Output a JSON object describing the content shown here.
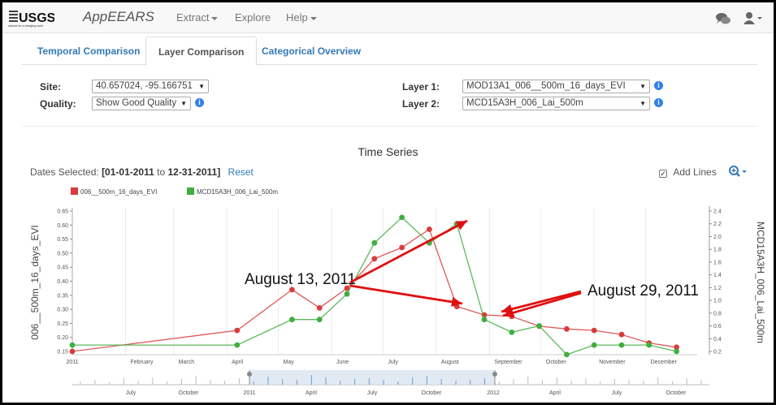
{
  "brand": {
    "logo": "USGS",
    "logo_tagline": "science for a changing world",
    "app": "AppEEARS"
  },
  "nav": {
    "extract": "Extract",
    "explore": "Explore",
    "help": "Help"
  },
  "tabs": [
    "Temporal Comparison",
    "Layer Comparison",
    "Categorical Overview"
  ],
  "active_tab": "Layer Comparison",
  "form": {
    "site_label": "Site:",
    "site_value": "40.657024, -95.166751",
    "quality_label": "Quality:",
    "quality_value": "Show Good Quality",
    "layer1_label": "Layer 1:",
    "layer1_value": "MOD13A1_006__500m_16_days_EVI",
    "layer2_label": "Layer 2:",
    "layer2_value": "MCD15A3H_006_Lai_500m"
  },
  "chart_header": {
    "title": "Time Series",
    "dates_prefix": "Dates Selected:",
    "date_start": "[01-01-2011",
    "date_to": "to",
    "date_end": "12-31-2011]",
    "reset": "Reset",
    "add_lines": "Add Lines",
    "add_lines_checked": true
  },
  "colors": {
    "evi": "#d93b3b",
    "lai": "#3fae3f",
    "arrow": "#e01010",
    "accent": "#337ab7"
  },
  "annotations": {
    "a1": "August 13, 2011",
    "a2": "August 29, 2011"
  },
  "chart_data": {
    "type": "line",
    "series": [
      {
        "name": "006__500m_16_days_EVI",
        "axis": "left",
        "color": "#d93b3b",
        "x": [
          "2011-01-01",
          "2011-04-07",
          "2011-05-09",
          "2011-05-25",
          "2011-06-10",
          "2011-06-26",
          "2011-07-12",
          "2011-07-28",
          "2011-08-13",
          "2011-08-29",
          "2011-09-14",
          "2011-09-30",
          "2011-10-16",
          "2011-11-01",
          "2011-11-17",
          "2011-12-03",
          "2011-12-19"
        ],
        "values": [
          0.15,
          0.225,
          0.37,
          0.305,
          0.375,
          0.48,
          0.52,
          0.585,
          0.31,
          0.28,
          0.275,
          0.24,
          0.23,
          0.225,
          0.21,
          0.18,
          0.165
        ]
      },
      {
        "name": "MCD15A3H_006_Lai_500m",
        "axis": "right",
        "color": "#3fae3f",
        "x": [
          "2011-01-01",
          "2011-04-07",
          "2011-05-09",
          "2011-05-25",
          "2011-06-10",
          "2011-06-26",
          "2011-07-12",
          "2011-07-28",
          "2011-08-13",
          "2011-08-29",
          "2011-09-14",
          "2011-09-30",
          "2011-10-16",
          "2011-11-01",
          "2011-11-17",
          "2011-12-03",
          "2011-12-19"
        ],
        "values": [
          0.3,
          0.3,
          0.7,
          0.7,
          1.1,
          1.9,
          2.3,
          1.9,
          2.2,
          0.7,
          0.5,
          0.6,
          0.15,
          0.3,
          0.3,
          0.3,
          0.2
        ]
      }
    ],
    "xlabels": [
      "2011",
      "February",
      "March",
      "April",
      "May",
      "June",
      "July",
      "August",
      "September",
      "October",
      "November",
      "December"
    ],
    "ylabel_left": "006__500m_16_days_EVI",
    "ylabel_right": "MCD15A3H_006_Lai_500m",
    "ylim_left": [
      0.15,
      0.65
    ],
    "yticks_left": [
      "0.15",
      "0.20",
      "0.25",
      "0.30",
      "0.35",
      "0.40",
      "0.45",
      "0.50",
      "0.55",
      "0.60",
      "0.65"
    ],
    "ylim_right": [
      0.2,
      2.4
    ],
    "yticks_right": [
      "0.2",
      "0.4",
      "0.6",
      "0.8",
      "1.0",
      "1.2",
      "1.4",
      "1.6",
      "1.8",
      "2.0",
      "2.2",
      "2.4"
    ],
    "navigator_labels": [
      "July",
      "October",
      "2011",
      "April",
      "July",
      "October",
      "2012",
      "April",
      "July",
      "October"
    ]
  }
}
